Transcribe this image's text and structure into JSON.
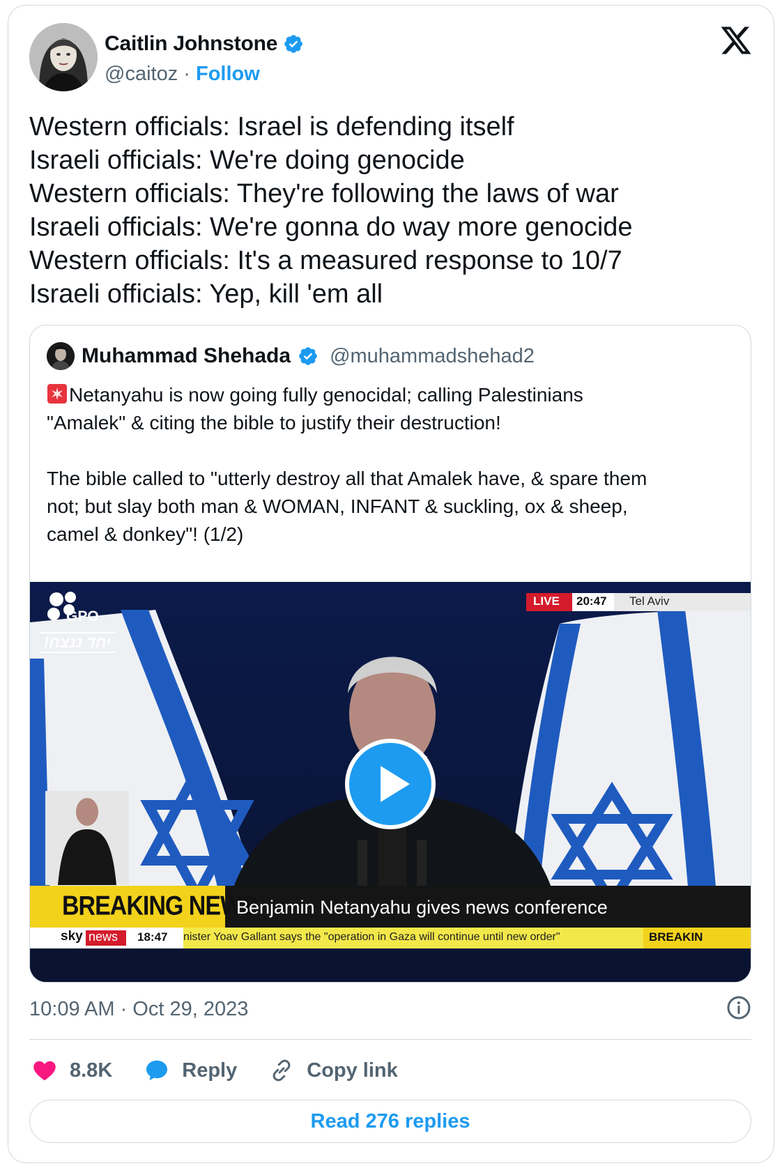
{
  "author": {
    "name": "Caitlin Johnstone",
    "handle": "@caitoz",
    "separator": " · ",
    "follow_label": "Follow"
  },
  "tweet_lines": [
    "Western officials: Israel is defending itself",
    "Israeli officials: We're doing genocide",
    "Western officials: They're following the laws of war",
    "Israeli officials: We're gonna do way more genocide",
    "Western officials: It's a measured response to 10/7",
    "Israeli officials: Yep, kill 'em all"
  ],
  "quote": {
    "name": "Muhammad Shehada",
    "handle": "@muhammadshehad2",
    "para1_line1": "Netanyahu is now going fully genocidal; calling Palestinians",
    "para1_line2": "\"Amalek\" & citing the bible to justify their destruction!",
    "para2_line1": "The bible called to \"utterly destroy all that Amalek have, & spare them",
    "para2_line2": "not; but slay both man & WOMAN, INFANT & suckling, ox & sheep,",
    "para2_line3": "camel & donkey\"! (1/2)"
  },
  "video": {
    "live_badge": "LIVE",
    "live_time": "20:47",
    "live_location": "Tel Aviv",
    "gpo_label": "GPO",
    "hebrew_label": "יחד ננצח!",
    "breaking_label": "BREAKING NEWS",
    "headline": "Benjamin Netanyahu gives news conference",
    "sky_label": "sky",
    "news_label": "news",
    "ticker_time": "18:47",
    "ticker_text": "nister Yoav Gallant says the \"operation in Gaza will continue until new order\"",
    "ticker_end": "BREAKIN"
  },
  "timestamp": "10:09 AM · Oct 29, 2023",
  "actions": {
    "likes": "8.8K",
    "reply": "Reply",
    "copy_link": "Copy link"
  },
  "read_replies": "Read 276 replies",
  "colors": {
    "accent": "#1d9bf0",
    "like": "#f91880",
    "muted": "#536471",
    "border": "#cfd9de"
  },
  "icons": [
    "verified-badge-icon",
    "x-logo-icon",
    "siren-icon",
    "play-icon",
    "info-icon",
    "heart-icon",
    "reply-bubble-icon",
    "link-icon"
  ]
}
